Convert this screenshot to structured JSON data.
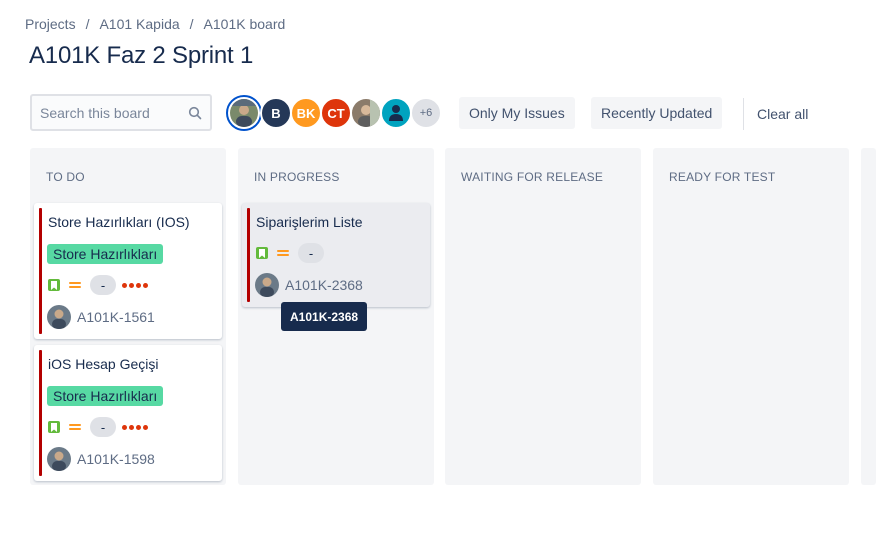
{
  "breadcrumb": {
    "items": [
      "Projects",
      "A101 Kapida",
      "A101K board"
    ],
    "separator": "/"
  },
  "page_title": "A101K Faz 2 Sprint 1",
  "search": {
    "placeholder": "Search this board",
    "value": ""
  },
  "avatars": {
    "items": [
      {
        "type": "photo",
        "color": "#6b778c",
        "selected": true
      },
      {
        "type": "initial",
        "label": "B",
        "color": "#253858"
      },
      {
        "type": "initial",
        "label": "BK",
        "color": "#ff991f"
      },
      {
        "type": "initial",
        "label": "CT",
        "color": "#de350b"
      },
      {
        "type": "photo",
        "color": "#8993a4"
      },
      {
        "type": "person-icon",
        "color": "#00a3bf"
      }
    ],
    "more_label": "+6"
  },
  "filters": {
    "only_my_issues": "Only My Issues",
    "recently_updated": "Recently Updated",
    "clear_all": "Clear all"
  },
  "columns": [
    {
      "title": "TO DO",
      "cards": [
        {
          "summary": "Store Hazırlıkları (IOS)",
          "epic": "Store Hazırlıkları",
          "estimate": "-",
          "key": "A101K-1561"
        },
        {
          "summary": "iOS Hesap Geçişi",
          "epic": "Store Hazırlıkları",
          "estimate": "-",
          "key": "A101K-1598"
        }
      ]
    },
    {
      "title": "IN PROGRESS",
      "cards": [
        {
          "summary": "Siparişlerim Liste",
          "estimate": "-",
          "key": "A101K-2368"
        }
      ]
    },
    {
      "title": "WAITING FOR RELEASE",
      "cards": []
    },
    {
      "title": "READY FOR TEST",
      "cards": []
    }
  ],
  "tooltip": "A101K-2368",
  "icons": {
    "search": "search-icon",
    "story": "story-icon",
    "priority": "priority-medium-icon",
    "dots": "priority-dots-icon"
  },
  "colors": {
    "accent": "#0052cc",
    "epic": "#57d9a3",
    "card_edge": "#b30000",
    "story": "#63ba3c",
    "priority": "#ff991f"
  }
}
